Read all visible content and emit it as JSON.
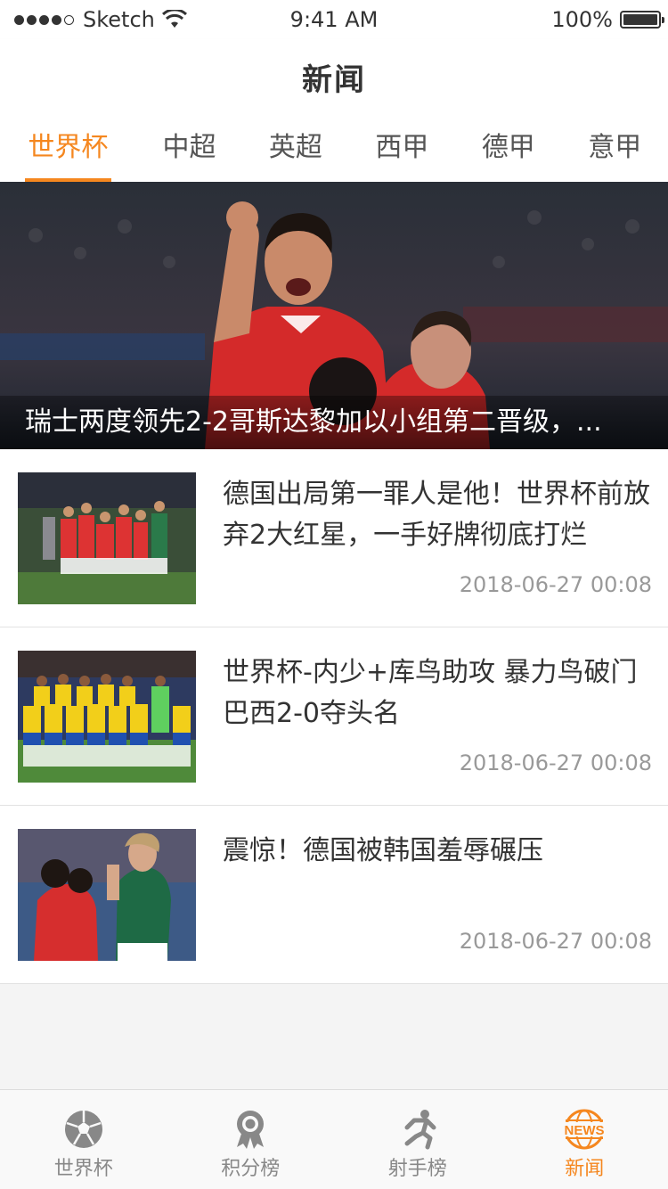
{
  "status_bar": {
    "carrier": "Sketch",
    "time": "9:41 AM",
    "battery": "100%"
  },
  "nav": {
    "title": "新闻"
  },
  "tabs": [
    {
      "label": "世界杯",
      "active": true
    },
    {
      "label": "中超",
      "active": false
    },
    {
      "label": "英超",
      "active": false
    },
    {
      "label": "西甲",
      "active": false
    },
    {
      "label": "德甲",
      "active": false
    },
    {
      "label": "意甲",
      "active": false
    }
  ],
  "hero": {
    "caption": "瑞士两度领先2-2哥斯达黎加以小组第二晋级，..."
  },
  "news": [
    {
      "title": "德国出局第一罪人是他！世界杯前放弃2大红星，一手好牌彻底打烂",
      "time": "2018-06-27 00:08"
    },
    {
      "title": "世界杯-内少+库鸟助攻 暴力鸟破门 巴西2-0夺头名",
      "time": "2018-06-27 00:08"
    },
    {
      "title": "震惊！德国被韩国羞辱碾压",
      "time": "2018-06-27 00:08"
    }
  ],
  "tabbar": [
    {
      "label": "世界杯",
      "icon": "soccer-ball-icon",
      "active": false
    },
    {
      "label": "积分榜",
      "icon": "medal-icon",
      "active": false
    },
    {
      "label": "射手榜",
      "icon": "runner-icon",
      "active": false
    },
    {
      "label": "新闻",
      "icon": "news-globe-icon",
      "active": true
    }
  ],
  "colors": {
    "accent": "#f5871f",
    "text": "#333333",
    "muted": "#999999",
    "background": "#f4f4f4"
  }
}
